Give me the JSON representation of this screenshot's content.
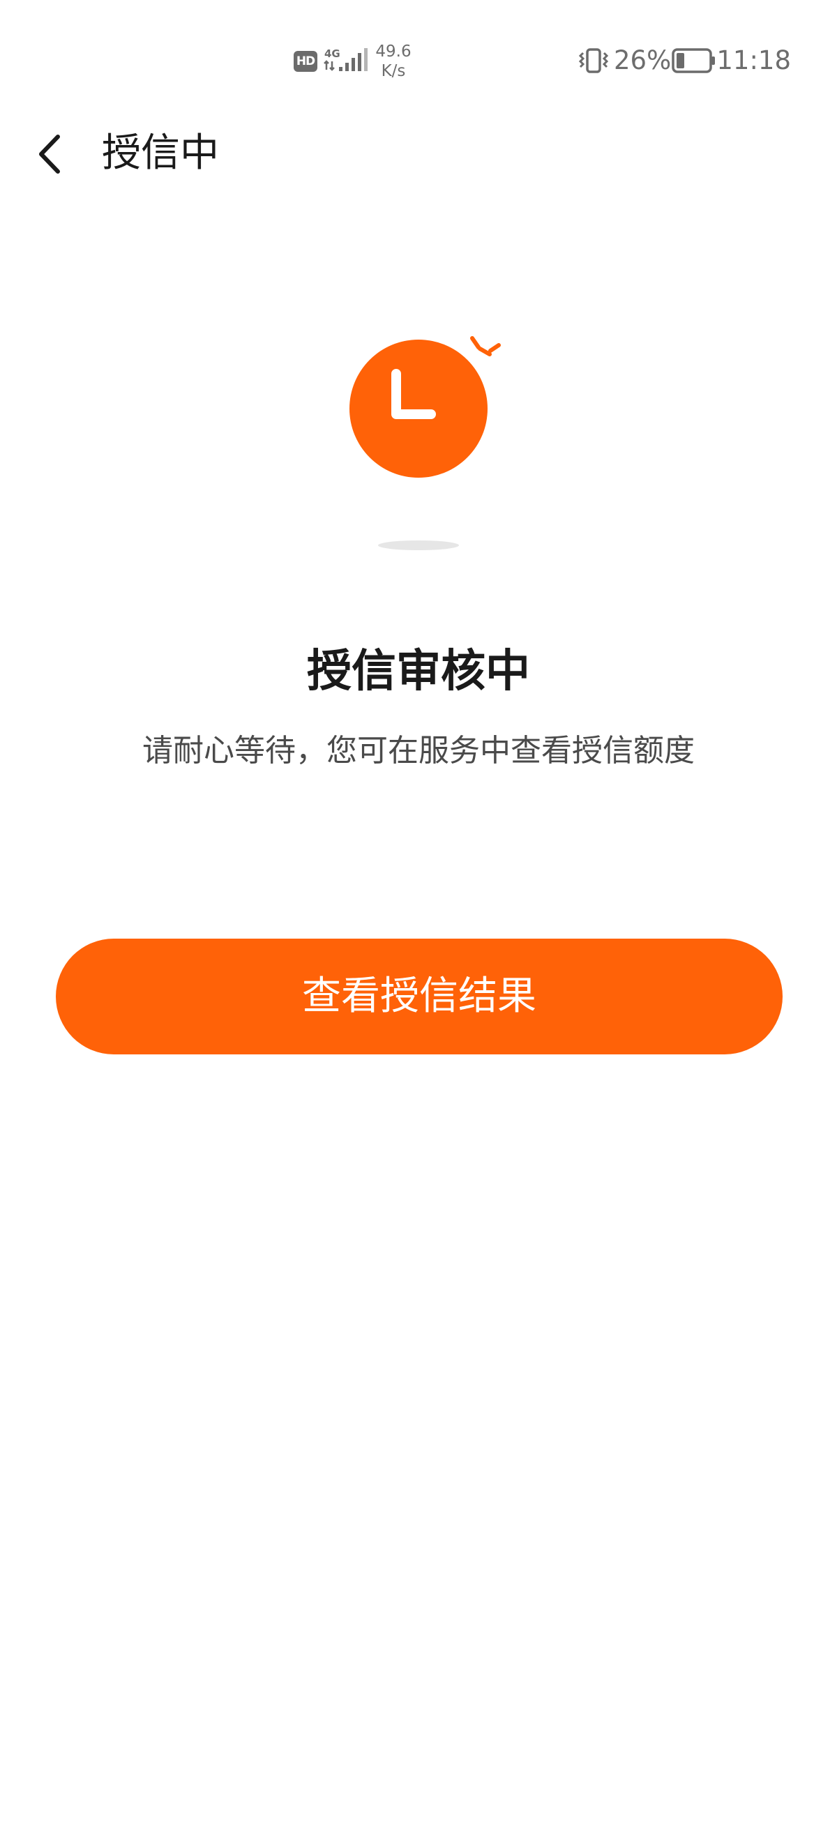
{
  "status_bar": {
    "hd_label": "HD",
    "network_speed_value": "49.6",
    "network_speed_unit": "K/s",
    "battery_percent": "26%",
    "battery_level": 0.26,
    "time": "11:18"
  },
  "header": {
    "back_icon": "chevron-left-icon",
    "title": "授信中"
  },
  "illustration": {
    "icon": "clock-icon",
    "accent_color": "#ff6208"
  },
  "status": {
    "title": "授信审核中",
    "subtitle": "请耐心等待，您可在服务中查看授信额度"
  },
  "actions": {
    "primary_label": "查看授信结果",
    "primary_color": "#ff6208"
  }
}
